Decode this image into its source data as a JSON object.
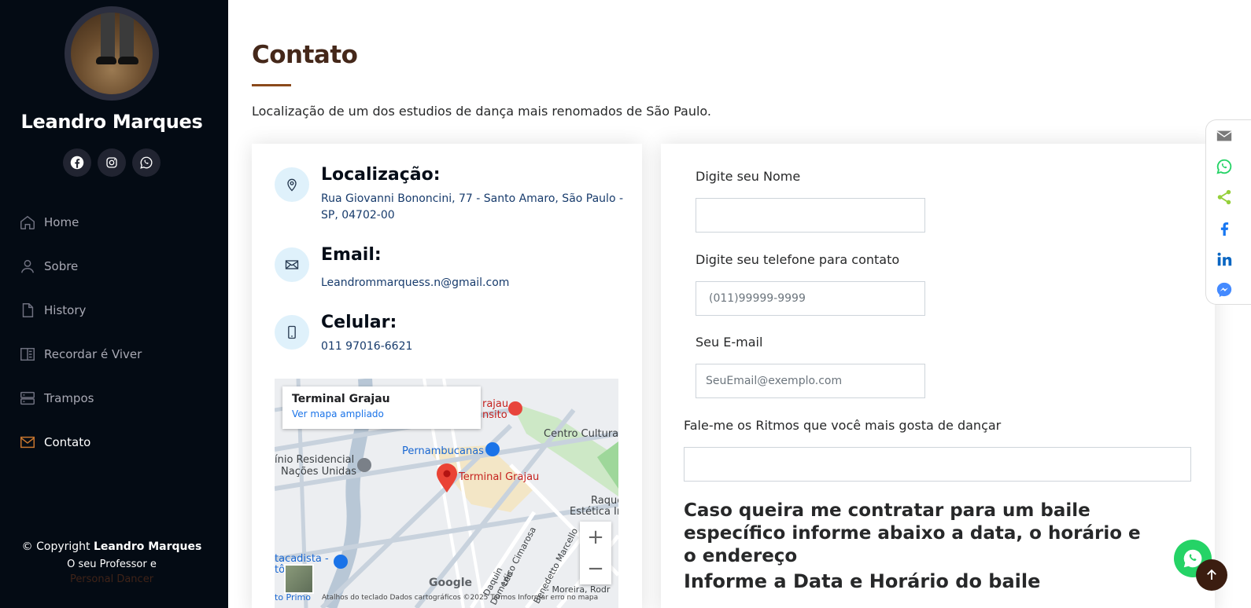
{
  "sidebar": {
    "name": "Leandro Marques",
    "nav": [
      {
        "label": "Home",
        "icon": "house-icon"
      },
      {
        "label": "Sobre",
        "icon": "person-icon"
      },
      {
        "label": "History",
        "icon": "file-icon"
      },
      {
        "label": "Recordar é Viver",
        "icon": "book-icon"
      },
      {
        "label": "Trampos",
        "icon": "server-icon"
      },
      {
        "label": "Contato",
        "icon": "envelope-icon",
        "active": true
      }
    ],
    "footer": {
      "copyright_prefix": "© Copyright ",
      "copyright_name": "Leandro Marques",
      "line2_prefix": "O seu Professor e ",
      "line2_muted": "Personal Dancer"
    }
  },
  "main": {
    "title": "Contato",
    "subtitle": "Localização de um dos estudios de dança mais renomados de São Paulo."
  },
  "info": {
    "location_title": "Localização:",
    "location_text": "Rua Giovanni Bononcini, 77 - Santo Amaro, São Paulo - SP, 04702-00",
    "email_title": "Email:",
    "email_text": "Leandrommarquess.n@gmail.com",
    "phone_title": "Celular:",
    "phone_text": "011 97016-6621"
  },
  "map": {
    "popup_title": "Terminal Grajau",
    "popup_link": "Ver mapa ampliado",
    "labels": {
      "pin": "Terminal Grajau",
      "store": "Pernambucanas",
      "residencial": "ínio Residencial",
      "nacoes": "Nações Unidas",
      "centro": "Centro Cultural",
      "transito1": "rajau",
      "transito2": "nsito",
      "raque": "Raque",
      "estetica": "Estética In",
      "atacadista": "tacadista -",
      "tela": "tô   ela",
      "cimarosa": "Domenico Cimarosa",
      "marcello": "Benedetto Marcello",
      "daquin": "Daquin",
      "leo": "Léo",
      "moreira": "- Moreira, Rodr",
      "primo": "to Primo"
    },
    "footer": "Atalhos do teclado    Dados cartográficos ©2025    Termos    Informar erro no mapa",
    "google": "Google",
    "zoom_in": "+",
    "zoom_out": "−"
  },
  "form": {
    "name_label": "Digite seu Nome",
    "name_value": "",
    "phone_label": "Digite seu telefone para contato",
    "phone_placeholder": "(011)99999-9999",
    "email_label": "Seu E-mail",
    "email_placeholder": "SeuEmail@exemplo.com",
    "rhythms_label": "Fale-me os Ritmos que você mais gosta de dançar",
    "rhythms_value": "",
    "hire_heading": "Caso queira me contratar para um baile específico informe abaixo a data, o horário e o endereço",
    "date_heading": "Informe a Data e Horário do baile"
  },
  "share_bar": {
    "items": [
      "email-icon",
      "whatsapp-icon",
      "share-icon",
      "facebook-icon",
      "linkedin-icon",
      "messenger-icon"
    ]
  },
  "colors": {
    "sidebar_bg": "#040b14",
    "accent": "#8b4a1c",
    "title": "#45281a",
    "whatsapp": "#25d366",
    "back_to_top": "#3b1d10"
  }
}
